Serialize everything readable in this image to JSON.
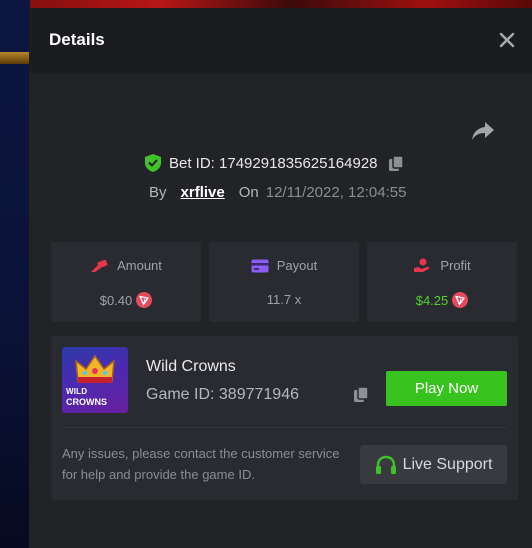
{
  "dialog": {
    "title": "Details"
  },
  "bet": {
    "id_text": "Bet ID: 1749291835625164928",
    "by_label": "By",
    "username": "xrflive",
    "on_label": "On",
    "date": "12/11/2022, 12:04:55"
  },
  "stats": [
    {
      "label": "Amount",
      "value": "$0.40",
      "icon": "amount-icon"
    },
    {
      "label": "Payout",
      "value": "11.7 x",
      "icon": "card-icon"
    },
    {
      "label": "Profit",
      "value": "$4.25",
      "icon": "profit-hand-icon"
    }
  ],
  "game": {
    "thumb_line1": "WILD",
    "thumb_line2": "CROWNS",
    "name": "Wild Crowns",
    "id_text": "Game ID: 389771946",
    "play_label": "Play Now",
    "note": "Any issues, please contact the customer service for help and provide the game ID.",
    "support_label": "Live Support"
  },
  "colors": {
    "accent_green": "#37c21e",
    "profit_green": "#4fd12c",
    "panel": "#222327",
    "card": "#2a2b30"
  }
}
